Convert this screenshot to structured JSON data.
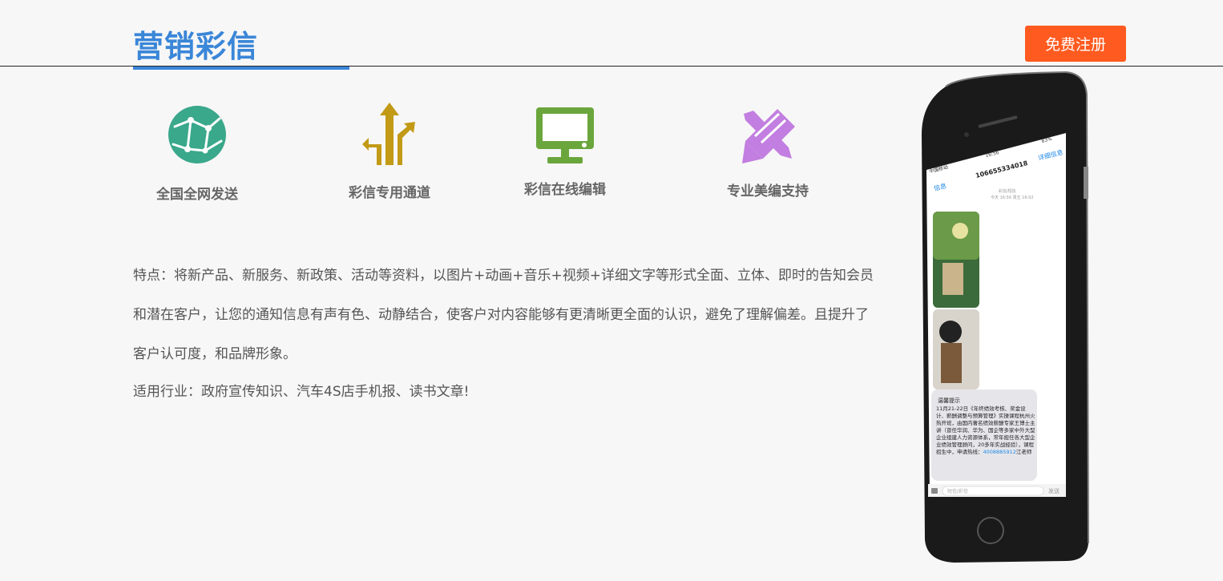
{
  "header": {
    "title": "营销彩信",
    "register_label": "免费注册"
  },
  "features": [
    {
      "icon": "globe-network-icon",
      "label": "全国全网发送",
      "color": "#3aa88b"
    },
    {
      "icon": "arrows-channel-icon",
      "label": "彩信专用通道",
      "color": "#c29a16"
    },
    {
      "icon": "monitor-icon",
      "label": "彩信在线编辑",
      "color": "#6aa63c"
    },
    {
      "icon": "pen-brush-icon",
      "label": "专业美编支持",
      "color": "#c27ee0"
    }
  ],
  "description": {
    "features_text": "特点：将新产品、新服务、新政策、活动等资料，以图片+动画+音乐+视频+详细文字等形式全面、立体、即时的告知会员和潜在客户，让您的通知信息有声有色、动静结合，使客户对内容能够有更清晰更全面的认识，避免了理解偏差。且提升了客户认可度，和品牌形象。",
    "industry_text": "适用行业：政府宣传知识、汽车4S店手机报、读书文章!"
  },
  "phone": {
    "carrier": "中国移动",
    "time": "16:56",
    "battery": "83%",
    "sender": "10665533401​8",
    "back_label": "信息",
    "detail_label": "详细信息",
    "msg_meta": "彩信/短信",
    "msg_date": "今天 16:56 周五 16:02",
    "notice_title": "温馨提示",
    "notice_body": "11月21-22日《年终绩效考核、奖金设计、薪酬调整与预算管理》实操课程杭州火热开班，由国内著名绩效薪酬专家王博士主讲（曾任华润、华为、国企等多家中外大型企业组建人力资源体系，常年担任各大型企业绩效管理顾问，20多年实战经验），课程招生中，",
    "notice_phone_prefix": "申请热线：",
    "notice_phone": "4008885912",
    "notice_phone_suffix": "江老师",
    "input_placeholder": "短信/彩信",
    "send_label": "发送"
  },
  "colors": {
    "accent": "#3a86d8",
    "button": "#ff5a1f",
    "background": "#f7f7f7"
  }
}
